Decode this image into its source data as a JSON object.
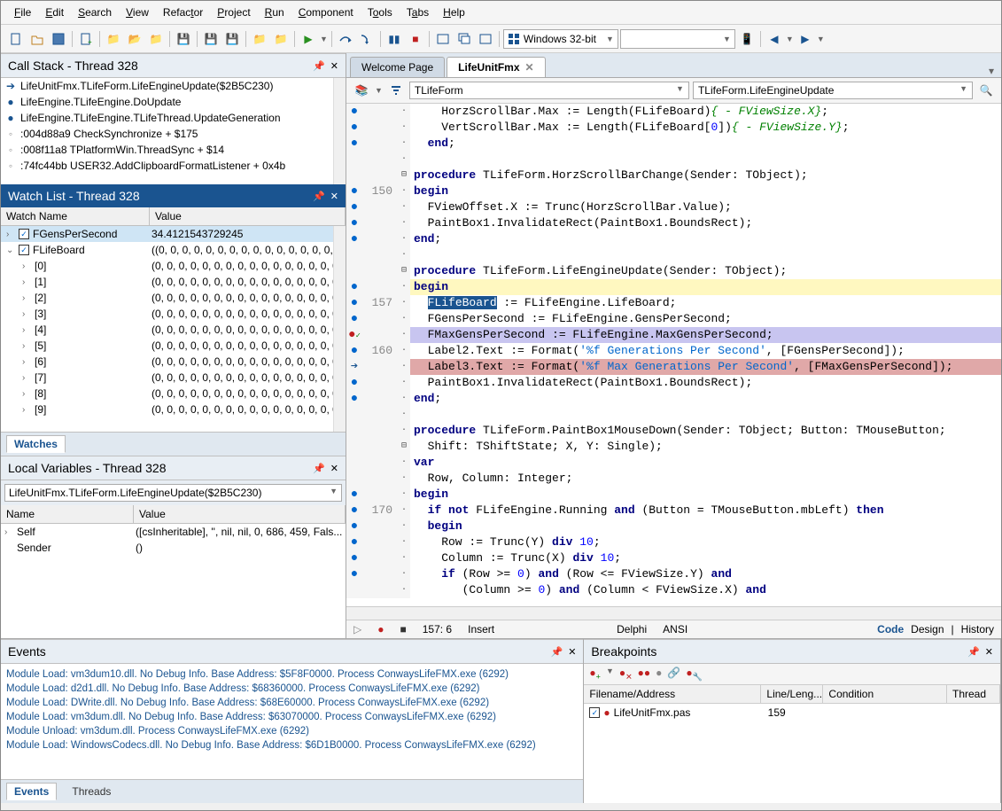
{
  "menu": [
    "File",
    "Edit",
    "Search",
    "View",
    "Refactor",
    "Project",
    "Run",
    "Component",
    "Tools",
    "Tabs",
    "Help"
  ],
  "toolbar": {
    "platform": "Windows 32-bit"
  },
  "callstack": {
    "title": "Call Stack - Thread 328",
    "items": [
      {
        "icon": "arrow",
        "text": "LifeUnitFmx.TLifeForm.LifeEngineUpdate($2B5C230)"
      },
      {
        "icon": "dot",
        "text": "LifeEngine.TLifeEngine.DoUpdate"
      },
      {
        "icon": "dot",
        "text": "LifeEngine.TLifeEngine.TLifeThread.UpdateGeneration"
      },
      {
        "icon": "gray",
        "text": ":004d88a9 CheckSynchronize + $175"
      },
      {
        "icon": "gray",
        "text": ":008f11a8 TPlatformWin.ThreadSync + $14"
      },
      {
        "icon": "gray",
        "text": ":74fc44bb USER32.AddClipboardFormatListener + 0x4b"
      }
    ]
  },
  "watchlist": {
    "title": "Watch List - Thread 328",
    "cols": [
      "Watch Name",
      "Value"
    ],
    "rows": [
      {
        "exp": "expand",
        "check": true,
        "name": "FGensPerSecond",
        "value": "34.4121543729245",
        "selected": true,
        "indent": 0
      },
      {
        "exp": "collapse",
        "check": true,
        "name": "FLifeBoard",
        "value": "((0, 0, 0, 0, 0, 0, 0, 0, 0, 0, 0, 0, 0, 0, 0, 0, ...",
        "indent": 0
      },
      {
        "exp": "expand",
        "name": "[0]",
        "value": "(0, 0, 0, 0, 0, 0, 0, 0, 0, 0, 0, 0, 0, 0, 0, 0, ...",
        "indent": 1
      },
      {
        "exp": "expand",
        "name": "[1]",
        "value": "(0, 0, 0, 0, 0, 0, 0, 0, 0, 0, 0, 0, 0, 0, 0, 0, ...",
        "indent": 1
      },
      {
        "exp": "expand",
        "name": "[2]",
        "value": "(0, 0, 0, 0, 0, 0, 0, 0, 0, 0, 0, 0, 0, 0, 0, 0, ...",
        "indent": 1
      },
      {
        "exp": "expand",
        "name": "[3]",
        "value": "(0, 0, 0, 0, 0, 0, 0, 0, 0, 0, 0, 0, 0, 0, 0, 0, ...",
        "indent": 1
      },
      {
        "exp": "expand",
        "name": "[4]",
        "value": "(0, 0, 0, 0, 0, 0, 0, 0, 0, 0, 0, 0, 0, 0, 0, 0, ...",
        "indent": 1
      },
      {
        "exp": "expand",
        "name": "[5]",
        "value": "(0, 0, 0, 0, 0, 0, 0, 0, 0, 0, 0, 0, 0, 0, 0, 0, ...",
        "indent": 1
      },
      {
        "exp": "expand",
        "name": "[6]",
        "value": "(0, 0, 0, 0, 0, 0, 0, 0, 0, 0, 0, 0, 0, 0, 0, 0, ...",
        "indent": 1
      },
      {
        "exp": "expand",
        "name": "[7]",
        "value": "(0, 0, 0, 0, 0, 0, 0, 0, 0, 0, 0, 0, 0, 0, 0, 0, ...",
        "indent": 1
      },
      {
        "exp": "expand",
        "name": "[8]",
        "value": "(0, 0, 0, 0, 0, 0, 0, 0, 0, 0, 0, 0, 0, 0, 0, 0, ...",
        "indent": 1
      },
      {
        "exp": "expand",
        "name": "[9]",
        "value": "(0, 0, 0, 0, 0, 0, 0, 0, 0, 0, 0, 0, 0, 0, 0, 0, ...",
        "indent": 1
      }
    ],
    "tab": "Watches"
  },
  "locals": {
    "title": "Local Variables - Thread 328",
    "context": "LifeUnitFmx.TLifeForm.LifeEngineUpdate($2B5C230)",
    "cols": [
      "Name",
      "Value"
    ],
    "rows": [
      {
        "exp": "expand",
        "name": "Self",
        "value": "([csInheritable], '', nil, nil, 0, 686, 459, Fals..."
      },
      {
        "exp": "none",
        "name": "Sender",
        "value": "()"
      }
    ]
  },
  "editor": {
    "tabs": [
      {
        "label": "Welcome Page",
        "active": false
      },
      {
        "label": "LifeUnitFmx",
        "active": true,
        "close": true
      }
    ],
    "class_combo": "TLifeForm",
    "method_combo": "TLifeForm.LifeEngineUpdate",
    "status": {
      "pos": "157:  6",
      "mode": "Insert",
      "lang": "Delphi",
      "encoding": "ANSI",
      "tabs": [
        "Code",
        "Design",
        "History"
      ]
    }
  },
  "events": {
    "title": "Events",
    "lines": [
      "Module Load: vm3dum10.dll. No Debug Info. Base Address: $5F8F0000. Process ConwaysLifeFMX.exe (6292)",
      "Module Load: d2d1.dll. No Debug Info. Base Address: $68360000. Process ConwaysLifeFMX.exe (6292)",
      "Module Load: DWrite.dll. No Debug Info. Base Address: $68E60000. Process ConwaysLifeFMX.exe (6292)",
      "Module Load: vm3dum.dll. No Debug Info. Base Address: $63070000. Process ConwaysLifeFMX.exe (6292)",
      "Module Unload: vm3dum.dll. Process ConwaysLifeFMX.exe (6292)",
      "Module Load: WindowsCodecs.dll. No Debug Info. Base Address: $6D1B0000. Process ConwaysLifeFMX.exe (6292)"
    ],
    "tabs": [
      "Events",
      "Threads"
    ]
  },
  "breakpoints": {
    "title": "Breakpoints",
    "cols": [
      "Filename/Address",
      "Line/Leng...",
      "Condition",
      "Thread"
    ],
    "row": {
      "file": "LifeUnitFmx.pas",
      "line": "159"
    }
  }
}
